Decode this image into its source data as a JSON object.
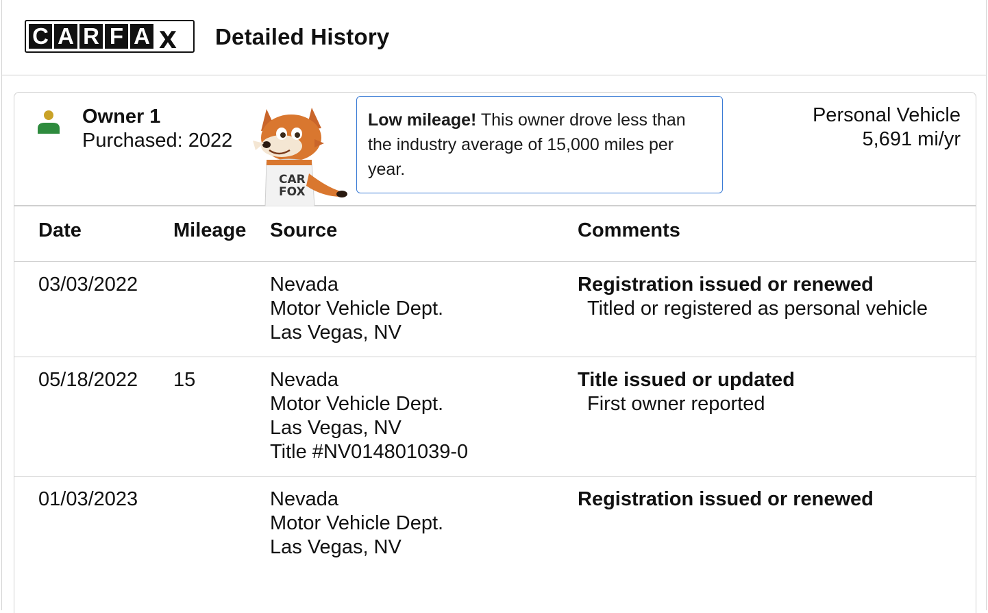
{
  "header": {
    "logo_letters": [
      "C",
      "A",
      "R",
      "F",
      "A",
      "X"
    ],
    "title": "Detailed History"
  },
  "owner": {
    "name": "Owner 1",
    "purchased": "Purchased: 2022",
    "vehicle_type": "Personal Vehicle",
    "miles_per_year": "5,691 mi/yr",
    "fox_shirt_text": [
      "CAR",
      "FOX"
    ],
    "callout": {
      "bold": "Low mileage!",
      "text": " This owner drove less than the industry average of 15,000 miles per year."
    }
  },
  "table": {
    "headers": {
      "date": "Date",
      "mileage": "Mileage",
      "source": "Source",
      "comments": "Comments"
    },
    "rows": [
      {
        "date": "03/03/2022",
        "mileage": "",
        "source": [
          "Nevada",
          "Motor Vehicle Dept.",
          "Las Vegas, NV"
        ],
        "comment_title": "Registration issued or renewed",
        "comment_detail": "Titled or registered as personal vehicle"
      },
      {
        "date": "05/18/2022",
        "mileage": "15",
        "source": [
          "Nevada",
          "Motor Vehicle Dept.",
          "Las Vegas, NV",
          "Title #NV014801039-0"
        ],
        "comment_title": "Title issued or updated",
        "comment_detail": "First owner reported"
      },
      {
        "date": "01/03/2023",
        "mileage": "",
        "source": [
          "Nevada",
          "Motor Vehicle Dept.",
          "Las Vegas, NV"
        ],
        "comment_title": "Registration issued or renewed",
        "comment_detail": ""
      }
    ]
  },
  "colors": {
    "person_head": "#c9a227",
    "person_body": "#2e8b3e",
    "callout_border": "#3a7bd5",
    "divider": "#cfcfcf"
  }
}
